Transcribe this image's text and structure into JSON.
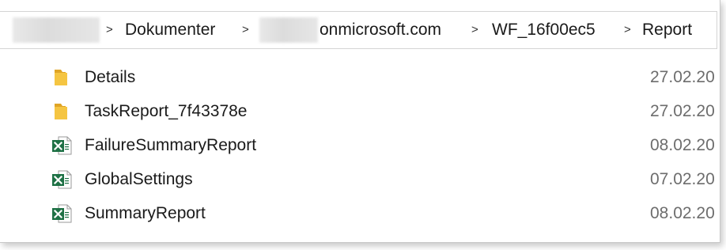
{
  "breadcrumb": {
    "separator": ">",
    "items": [
      {
        "label": "Dokumenter"
      },
      {
        "label": "onmicrosoft.com"
      },
      {
        "label": "WF_16f00ec5"
      },
      {
        "label": "Report"
      }
    ]
  },
  "files": [
    {
      "name": "Details",
      "icon": "folder-icon",
      "date": "27.02.20"
    },
    {
      "name": "TaskReport_7f43378e",
      "icon": "folder-icon",
      "date": "27.02.20"
    },
    {
      "name": "FailureSummaryReport",
      "icon": "excel-file-icon",
      "date": "08.02.20"
    },
    {
      "name": "GlobalSettings",
      "icon": "excel-file-icon",
      "date": "07.02.20"
    },
    {
      "name": "SummaryReport",
      "icon": "excel-file-icon",
      "date": "08.02.20"
    }
  ],
  "colors": {
    "folder": "#f5c542",
    "folder_dark": "#e0a526",
    "excel": "#1e7145"
  }
}
